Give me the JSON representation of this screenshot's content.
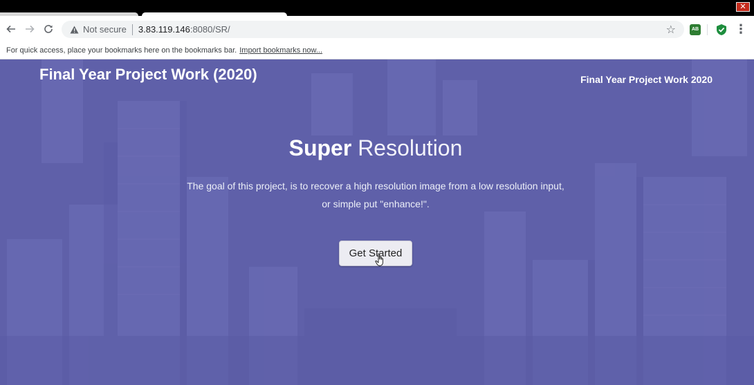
{
  "browser": {
    "close_glyph": "✕",
    "back_icon": "arrow-left-icon",
    "forward_icon": "arrow-right-icon",
    "reload_icon": "reload-icon",
    "security_label": "Not secure",
    "url_host": "3.83.119.146",
    "url_rest": ":8080/SR/",
    "extension_label": "AB",
    "bookmarks_bar_text": "For quick access, place your bookmarks here on the bookmarks bar.",
    "bookmarks_import_link": "Import bookmarks now..."
  },
  "page": {
    "brand": "Final Year Project Work (2020)",
    "top_right_label": "Final Year Project Work 2020",
    "hero_title_bold": "Super",
    "hero_title_light": "Resolution",
    "hero_description_line1": "The goal of this project, is to recover a high resolution image from a low resolution input,",
    "hero_description_line2": "or simple put \"enhance!\".",
    "cta_label": "Get Started"
  },
  "colors": {
    "hero_overlay": "#6264b2",
    "cta_background": "#ececf2",
    "warning_accent": "#5f6368"
  }
}
